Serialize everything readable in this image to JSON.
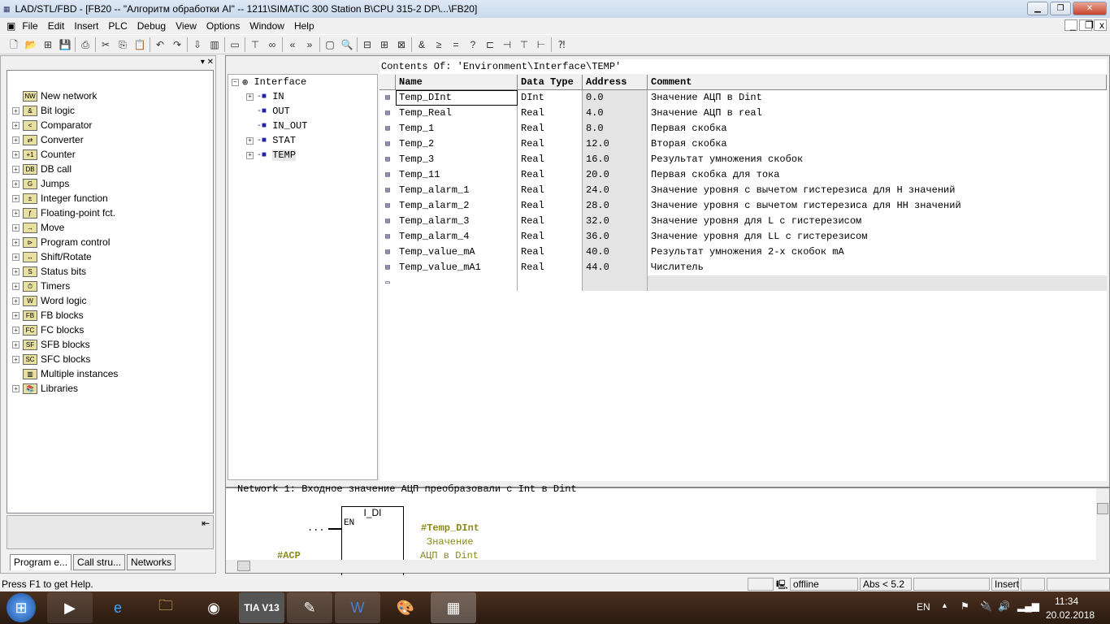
{
  "window": {
    "title": "LAD/STL/FBD  - [FB20 -- \"Алгоритм обработки AI\" -- 1211\\SIMATIC 300 Station B\\CPU 315-2 DP\\...\\FB20]"
  },
  "menu": [
    "File",
    "Edit",
    "Insert",
    "PLC",
    "Debug",
    "View",
    "Options",
    "Window",
    "Help"
  ],
  "toolbar_icons": [
    "new-icon",
    "open-icon",
    "accessible-nodes-icon",
    "save-icon",
    "print-icon",
    "cut-icon",
    "copy-icon",
    "paste-icon",
    "undo-icon",
    "redo-icon",
    "load-icon",
    "monitor-icon",
    "overview-icon",
    "network-icon",
    "glasses-icon",
    "prev-icon",
    "next-icon",
    "details-icon",
    "search-icon",
    "new-network-icon",
    "insert-icon",
    "branch-icon",
    "and-icon",
    "or-icon",
    "assign-icon",
    "empty-box-icon",
    "branch-open-icon",
    "branch-close-icon",
    "contact-icon",
    "coil-icon",
    "help-icon"
  ],
  "left_tree": [
    "New network",
    "Bit logic",
    "Comparator",
    "Converter",
    "Counter",
    "DB call",
    "Jumps",
    "Integer function",
    "Floating-point fct.",
    "Move",
    "Program control",
    "Shift/Rotate",
    "Status bits",
    "Timers",
    "Word logic",
    "FB blocks",
    "FC blocks",
    "SFB blocks",
    "SFC blocks",
    "Multiple instances",
    "Libraries"
  ],
  "left_tabs": [
    "Program e...",
    "Call stru...",
    "Networks"
  ],
  "interface_tree": {
    "root": "Interface",
    "items": [
      "IN",
      "OUT",
      "IN_OUT",
      "STAT",
      "TEMP"
    ]
  },
  "contents_path": "Contents Of: 'Environment\\Interface\\TEMP'",
  "table": {
    "headers": [
      "Name",
      "Data Type",
      "Address",
      "Comment"
    ],
    "rows": [
      [
        "Temp_DInt",
        "DInt",
        "0.0",
        "Значение АЦП в Dint"
      ],
      [
        "Temp_Real",
        "Real",
        "4.0",
        "Значение АЦП в real"
      ],
      [
        "Temp_1",
        "Real",
        "8.0",
        "Первая скобка"
      ],
      [
        "Temp_2",
        "Real",
        "12.0",
        "Вторая скобка"
      ],
      [
        "Temp_3",
        "Real",
        "16.0",
        "Результат умножения скобок"
      ],
      [
        "Temp_11",
        "Real",
        "20.0",
        "Первая скобка для тока"
      ],
      [
        "Temp_alarm_1",
        "Real",
        "24.0",
        "Значение уровня с вычетом гистерезиса для H значений"
      ],
      [
        "Temp_alarm_2",
        "Real",
        "28.0",
        "Значение уровня с вычетом гистерезиса для HH значений"
      ],
      [
        "Temp_alarm_3",
        "Real",
        "32.0",
        "Значение уровня для L с гистерезисом"
      ],
      [
        "Temp_alarm_4",
        "Real",
        "36.0",
        "Значение уровня для LL с гистерезисом"
      ],
      [
        "Temp_value_mA",
        "Real",
        "40.0",
        "Результат умножения 2-х скобок mA"
      ],
      [
        "Temp_value_mA1",
        "Real",
        "44.0",
        "Числитель"
      ]
    ]
  },
  "network": {
    "title": "Network 1: Входное значение АЦП преобразовали с Int в Dint",
    "box": "I_DI",
    "en": "EN",
    "dots": "...",
    "input": "#ACP",
    "output": "#Temp_DInt",
    "out_comment1": "Значение",
    "out_comment2": "АЦП в Dint"
  },
  "status": {
    "help": "Press F1 to get Help.",
    "mode": "offline",
    "abs": "Abs < 5.2",
    "insert": "Insert"
  },
  "tray": {
    "lang": "EN",
    "time": "11:34",
    "date": "20.02.2018"
  },
  "taskbar": [
    "start",
    "media",
    "ie",
    "explorer",
    "chrome",
    "TIA V13",
    "simatic",
    "word",
    "paint",
    "lad"
  ]
}
